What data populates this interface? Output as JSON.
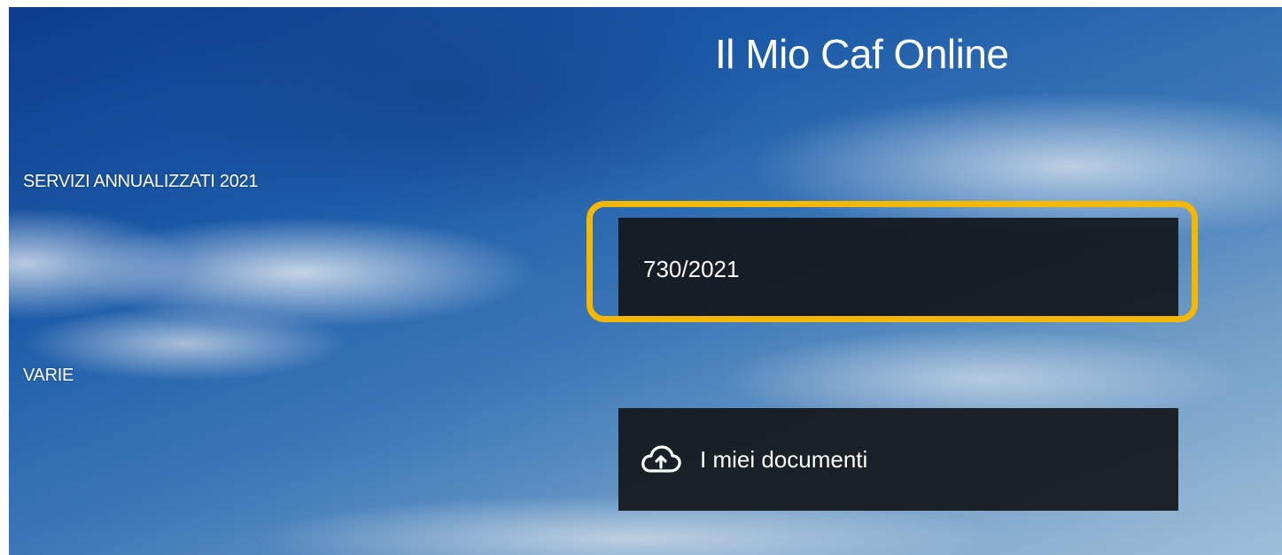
{
  "header": {
    "title": "Il Mio Caf Online"
  },
  "sections": {
    "servizi_label": "SERVIZI ANNUALIZZATI 2021",
    "varie_label": "VARIE"
  },
  "tiles": {
    "servizio_730": "730/2021",
    "documenti": "I miei documenti",
    "documenti_icon": "cloud-upload-icon"
  },
  "colors": {
    "highlight": "#f5b800",
    "tile_background": "#16181c",
    "text": "#ffffff"
  }
}
